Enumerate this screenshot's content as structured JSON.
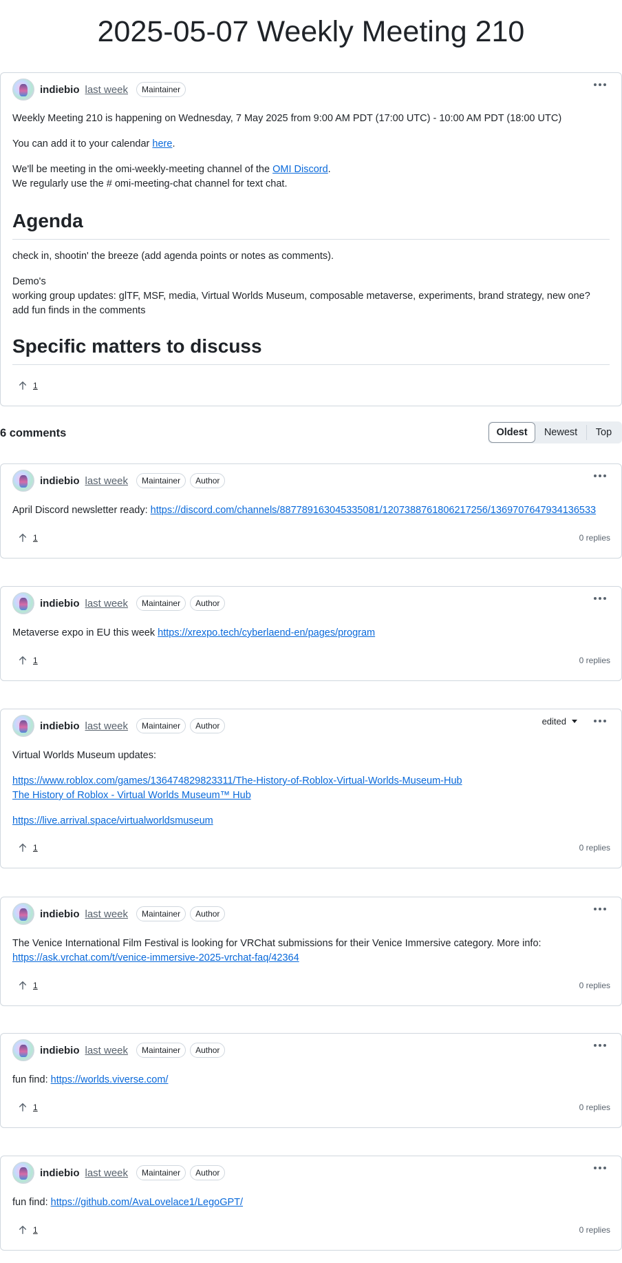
{
  "page": {
    "title": "2025-05-07 Weekly Meeting 210"
  },
  "post": {
    "author": "indiebio",
    "time": "last week",
    "badges": [
      "Maintainer"
    ],
    "line1": "Weekly Meeting 210 is happening on Wednesday, 7 May 2025 from 9:00 AM PDT (17:00 UTC) - 10:00 AM PDT (18:00 UTC)",
    "calendar_prefix": "You can add it to your calendar ",
    "calendar_link": "here",
    "calendar_suffix": ".",
    "discord_prefix": "We'll be meeting in the omi-weekly-meeting channel of the ",
    "discord_link": "OMI Discord",
    "discord_suffix": ".",
    "chat_line": "We regularly use the # omi-meeting-chat channel for text chat.",
    "agenda_heading": "Agenda",
    "agenda_line1": "check in, shootin' the breeze (add agenda points or notes as comments).",
    "agenda_line2": "Demo's",
    "agenda_line3": "working group updates: glTF, MSF, media, Virtual Worlds Museum, composable metaverse, experiments, brand strategy, new one?",
    "agenda_line4": "add fun finds in the comments",
    "matters_heading": "Specific matters to discuss",
    "upvotes": "1"
  },
  "comments_header": {
    "count_label": "6 comments",
    "sort_options": [
      "Oldest",
      "Newest",
      "Top"
    ],
    "active_sort": "Oldest"
  },
  "comments": [
    {
      "author": "indiebio",
      "time": "last week",
      "badges": [
        "Maintainer",
        "Author"
      ],
      "text_prefix": "April Discord newsletter ready: ",
      "link": "https://discord.com/channels/887789163045335081/1207388761806217256/1369707647934136533",
      "upvotes": "1",
      "replies": "0 replies"
    },
    {
      "author": "indiebio",
      "time": "last week",
      "badges": [
        "Maintainer",
        "Author"
      ],
      "text_prefix": "Metaverse expo in EU this week ",
      "link": "https://xrexpo.tech/cyberlaend-en/pages/program",
      "upvotes": "1",
      "replies": "0 replies"
    },
    {
      "author": "indiebio",
      "time": "last week",
      "badges": [
        "Maintainer",
        "Author"
      ],
      "edited_label": "edited",
      "text": "Virtual Worlds Museum updates:",
      "link1": "https://www.roblox.com/games/136474829823311/The-History-of-Roblox-Virtual-Worlds-Museum-Hub",
      "link2": "The History of Roblox - Virtual Worlds Museum™ Hub",
      "link3": "https://live.arrival.space/virtualworldsmuseum",
      "upvotes": "1",
      "replies": "0 replies"
    },
    {
      "author": "indiebio",
      "time": "last week",
      "badges": [
        "Maintainer",
        "Author"
      ],
      "text": "The Venice International Film Festival is looking for VRChat submissions for their Venice Immersive category. More info:",
      "link": "https://ask.vrchat.com/t/venice-immersive-2025-vrchat-faq/42364",
      "upvotes": "1",
      "replies": "0 replies"
    },
    {
      "author": "indiebio",
      "time": "last week",
      "badges": [
        "Maintainer",
        "Author"
      ],
      "text_prefix": "fun find: ",
      "link": "https://worlds.viverse.com/",
      "upvotes": "1",
      "replies": "0 replies"
    },
    {
      "author": "indiebio",
      "time": "last week",
      "badges": [
        "Maintainer",
        "Author"
      ],
      "text_prefix": "fun find: ",
      "link": "https://github.com/AvaLovelace1/LegoGPT/",
      "upvotes": "1",
      "replies": "0 replies"
    }
  ],
  "icons": {
    "avatar": "avatar-image",
    "menu": "kebab-horizontal-icon",
    "upvote": "arrow-up-icon",
    "caret": "triangle-down-icon"
  }
}
